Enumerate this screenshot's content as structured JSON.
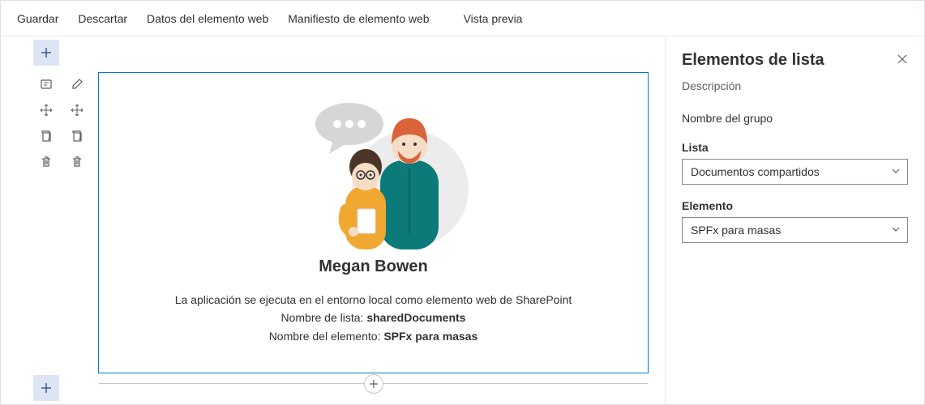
{
  "toolbar": {
    "save": "Guardar",
    "discard": "Descartar",
    "webpart_data": "Datos del elemento web",
    "webpart_manifest": "Manifiesto de elemento web",
    "preview": "Vista previa"
  },
  "webpart": {
    "person_name": "Megan Bowen",
    "app_description": "La aplicación se ejecuta en el entorno local como elemento web de SharePoint",
    "list_name_label": "Nombre de lista: ",
    "list_name_value": "sharedDocuments",
    "element_name_label": "Nombre del elemento: ",
    "element_name_value": "SPFx para masas"
  },
  "panel": {
    "title": "Elementos de lista",
    "description": "Descripción",
    "group_name": "Nombre del grupo",
    "list_label": "Lista",
    "list_value": "Documentos compartidos",
    "element_label": "Elemento",
    "element_value": "SPFx para masas"
  }
}
